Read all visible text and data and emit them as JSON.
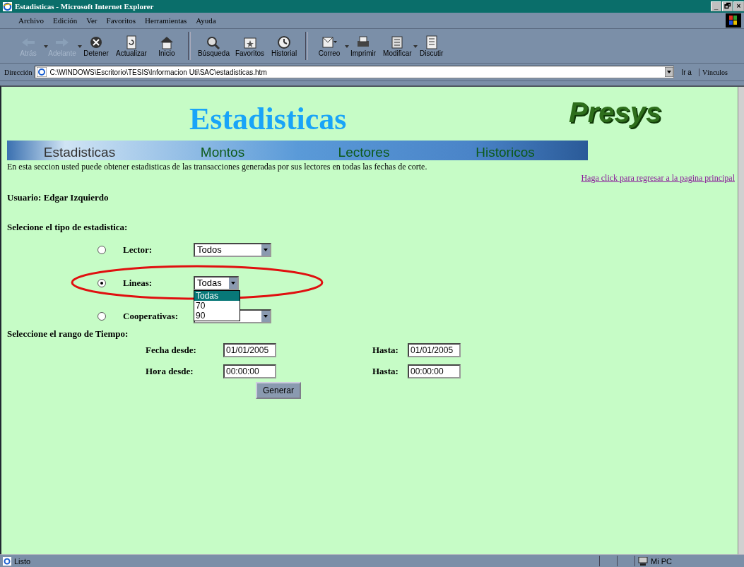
{
  "window": {
    "title": "Estadisticas - Microsoft Internet Explorer",
    "controls": [
      "_",
      "🗗",
      "×"
    ]
  },
  "menu": [
    "Archivo",
    "Edición",
    "Ver",
    "Favoritos",
    "Herramientas",
    "Ayuda"
  ],
  "toolbar": [
    {
      "kind": "back",
      "label": "Atrás",
      "disabled": true,
      "dropdown": true
    },
    {
      "kind": "forward",
      "label": "Adelante",
      "disabled": true,
      "dropdown": true
    },
    {
      "kind": "stop",
      "label": "Detener",
      "disabled": false,
      "dropdown": false
    },
    {
      "kind": "refresh",
      "label": "Actualizar",
      "disabled": false,
      "dropdown": false
    },
    {
      "kind": "home",
      "label": "Inicio",
      "disabled": false,
      "dropdown": false
    },
    {
      "kind": "search",
      "label": "Búsqueda",
      "disabled": false,
      "dropdown": false
    },
    {
      "kind": "favorites",
      "label": "Favoritos",
      "disabled": false,
      "dropdown": false
    },
    {
      "kind": "history",
      "label": "Historial",
      "disabled": false,
      "dropdown": false
    },
    {
      "kind": "mail",
      "label": "Correo",
      "disabled": false,
      "dropdown": true
    },
    {
      "kind": "print",
      "label": "Imprimir",
      "disabled": false,
      "dropdown": false
    },
    {
      "kind": "edit",
      "label": "Modificar",
      "disabled": false,
      "dropdown": true
    },
    {
      "kind": "discuss",
      "label": "Discutir",
      "disabled": false,
      "dropdown": false
    }
  ],
  "address": {
    "label": "Dirección",
    "value": "C:\\WINDOWS\\Escritorio\\TESIS\\Informacion Uti\\SAC\\estadisticas.htm",
    "go": "Ir a",
    "links": "Vínculos"
  },
  "page": {
    "heading": "Estadisticas",
    "logo": "Presys",
    "nav": [
      {
        "label": "Estadisticas",
        "selected": true
      },
      {
        "label": "Montos",
        "selected": false
      },
      {
        "label": "Lectores",
        "selected": false
      },
      {
        "label": "Historicos",
        "selected": false
      }
    ],
    "intro": "En esta seccion usted puede obtener estadisticas de las transacciones generadas por sus lectores en todas las fechas de corte.",
    "back_link": "Haga click para regresar a la pagina principal",
    "user": "Usuario: Edgar Izquierdo",
    "type_label": "Selecione el tipo de estadistica:",
    "types": [
      {
        "label": "Lector:",
        "selected": false,
        "value": "Todos",
        "highlighted": false
      },
      {
        "label": "Lineas:",
        "selected": true,
        "value": "Todas",
        "highlighted": true,
        "options": [
          {
            "label": "Todas",
            "selected": true
          },
          {
            "label": "70",
            "selected": false
          },
          {
            "label": "90",
            "selected": false
          }
        ]
      },
      {
        "label": "Cooperativas:",
        "selected": false,
        "highlighted": false
      }
    ],
    "range_label": "Seleccione el rango de Tiempo:",
    "ranges": [
      {
        "from_label": "Fecha desde:",
        "from": "01/01/2005",
        "to_label": "Hasta:",
        "to": "01/01/2005"
      },
      {
        "from_label": "Hora desde:",
        "from": "00:00:00",
        "to_label": "Hasta:",
        "to": "00:00:00"
      }
    ],
    "button": "Generar"
  },
  "status": {
    "text": "Listo",
    "zone": "Mi PC"
  }
}
